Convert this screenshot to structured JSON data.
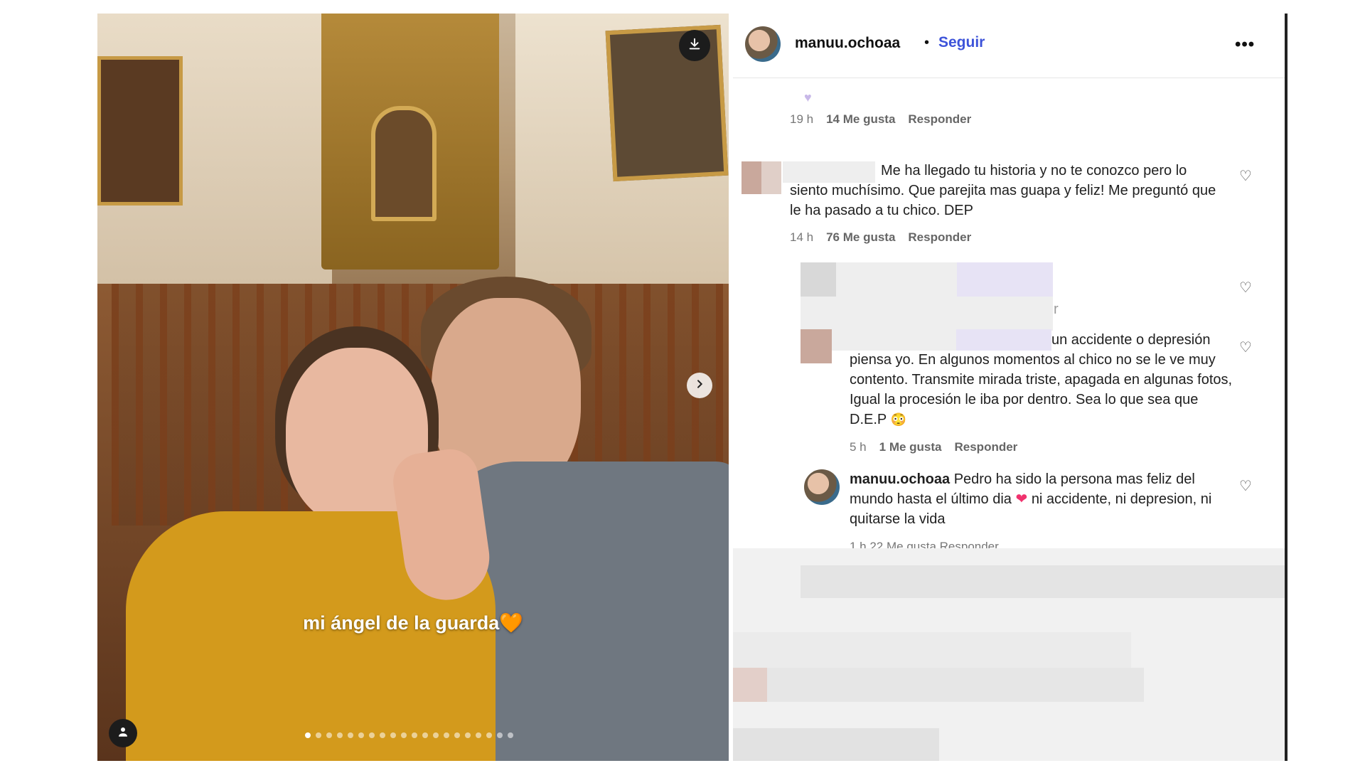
{
  "post": {
    "caption": "mi ángel de la guarda",
    "caption_emoji": "🧡",
    "carousel_total": 20,
    "carousel_current": 1
  },
  "header": {
    "username": "manuu.ochoaa",
    "separator": "•",
    "follow_label": "Seguir",
    "more_label": "•••"
  },
  "comments": [
    {
      "id": "c0",
      "time": "19 h",
      "likes": "14 Me gusta",
      "reply": "Responder"
    },
    {
      "id": "c1",
      "text": "Me ha llegado tu historia y no te conozco pero lo siento muchísimo. Que parejita mas guapa y feliz! Me preguntó que le ha pasado a tu chico. DEP",
      "time": "14 h",
      "likes": "76 Me gusta",
      "reply": "Responder"
    },
    {
      "id": "c2",
      "text_fragment": "r"
    },
    {
      "id": "c3",
      "text": "un accidente o depresión piensa yo. En algunos momentos al chico no se le ve muy contento. Transmite mirada triste, apagada en algunas fotos, Igual la procesión le iba por dentro. Sea lo que sea que D.E.P",
      "time": "5 h",
      "likes": "1 Me gusta",
      "reply": "Responder"
    },
    {
      "id": "c4",
      "username": "manuu.ochoaa",
      "text": "Pedro ha sido la persona mas feliz del mundo hasta el último dia",
      "text_after": "ni accidente, ni depresion, ni quitarse la vida",
      "heart_emoji": "❤",
      "meta_partial": "1 h   22 Me gusta   Responder"
    }
  ],
  "icons": {
    "download": "download-icon",
    "next": "chevron-right-icon",
    "user_tag": "user-icon",
    "like": "heart-outline-icon"
  },
  "colors": {
    "follow": "#3d53d9",
    "caption_heart": "#f6a23a",
    "inline_heart": "#f0326e"
  }
}
